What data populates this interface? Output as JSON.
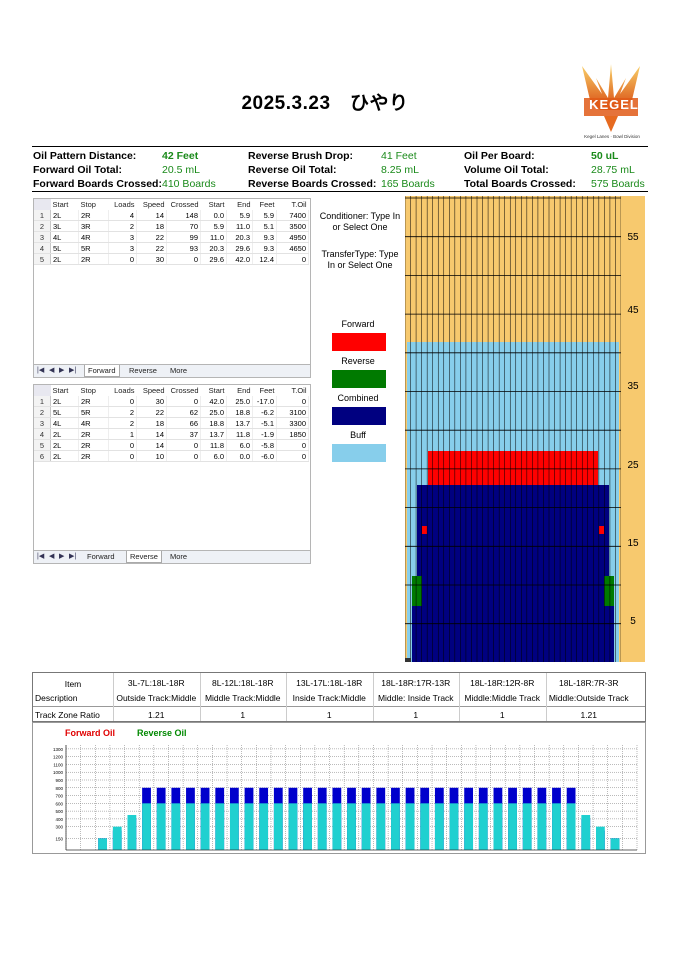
{
  "title": "2025.3.23　ひやり",
  "logo": {
    "text": "KEGEL",
    "caption": "Kegel Lanes · Bowl Division"
  },
  "summary": {
    "oil_pattern_distance_label": "Oil Pattern Distance:",
    "oil_pattern_distance": "42 Feet",
    "forward_oil_total_label": "Forward Oil Total:",
    "forward_oil_total": "20.5 mL",
    "forward_boards_crossed_label": "Forward Boards Crossed:",
    "forward_boards_crossed": "410 Boards",
    "reverse_brush_drop_label": "Reverse Brush Drop:",
    "reverse_brush_drop": "41 Feet",
    "reverse_oil_total_label": "Reverse Oil Total:",
    "reverse_oil_total": "8.25 mL",
    "reverse_boards_crossed_label": "Reverse Boards Crossed:",
    "reverse_boards_crossed": "165 Boards",
    "oil_per_board_label": "Oil Per Board:",
    "oil_per_board": "50 uL",
    "volume_oil_total_label": "Volume Oil Total:",
    "volume_oil_total": "28.75 mL",
    "total_boards_crossed_label": "Total Boards Crossed:",
    "total_boards_crossed": "575 Boards"
  },
  "forward_table": {
    "columns": [
      "Start",
      "Stop",
      "Loads",
      "Speed",
      "Crossed",
      "Start",
      "End",
      "Feet",
      "T.Oil"
    ],
    "rows": [
      [
        "1",
        "2L",
        "2R",
        "4",
        "14",
        "148",
        "0.0",
        "5.9",
        "5.9",
        "7400"
      ],
      [
        "2",
        "3L",
        "3R",
        "2",
        "18",
        "70",
        "5.9",
        "11.0",
        "5.1",
        "3500"
      ],
      [
        "3",
        "4L",
        "4R",
        "3",
        "22",
        "99",
        "11.0",
        "20.3",
        "9.3",
        "4950"
      ],
      [
        "4",
        "5L",
        "5R",
        "3",
        "22",
        "93",
        "20.3",
        "29.6",
        "9.3",
        "4650"
      ],
      [
        "5",
        "2L",
        "2R",
        "0",
        "30",
        "0",
        "29.6",
        "42.0",
        "12.4",
        "0"
      ]
    ],
    "tabs": [
      "Forward",
      "Reverse",
      "More"
    ]
  },
  "reverse_table": {
    "columns": [
      "Start",
      "Stop",
      "Loads",
      "Speed",
      "Crossed",
      "Start",
      "End",
      "Feet",
      "T.Oil"
    ],
    "rows": [
      [
        "1",
        "2L",
        "2R",
        "0",
        "30",
        "0",
        "42.0",
        "25.0",
        "-17.0",
        "0"
      ],
      [
        "2",
        "5L",
        "5R",
        "2",
        "22",
        "62",
        "25.0",
        "18.8",
        "-6.2",
        "3100"
      ],
      [
        "3",
        "4L",
        "4R",
        "2",
        "18",
        "66",
        "18.8",
        "13.7",
        "-5.1",
        "3300"
      ],
      [
        "4",
        "2L",
        "2R",
        "1",
        "14",
        "37",
        "13.7",
        "11.8",
        "-1.9",
        "1850"
      ],
      [
        "5",
        "2L",
        "2R",
        "0",
        "14",
        "0",
        "11.8",
        "6.0",
        "-5.8",
        "0"
      ],
      [
        "6",
        "2L",
        "2R",
        "0",
        "10",
        "0",
        "6.0",
        "0.0",
        "-6.0",
        "0"
      ]
    ],
    "tabs": [
      "Forward",
      "Reverse",
      "More"
    ]
  },
  "conditioner": {
    "conditioner_text": "Conditioner: Type In or Select One",
    "transfer_text": "TransferType: Type In or Select One"
  },
  "legend": [
    {
      "name": "Forward",
      "color": "#ff0000"
    },
    {
      "name": "Reverse",
      "color": "#007a00"
    },
    {
      "name": "Combined",
      "color": "#000080"
    },
    {
      "name": "Buff",
      "color": "#87ceeb"
    }
  ],
  "lane_graph": {
    "feet_markers": [
      "55",
      "45",
      "35",
      "25",
      "15",
      "5"
    ],
    "colors": {
      "wood": "#f7c96e",
      "buff": "#87ceeb",
      "forward": "#ff0000",
      "reverse": "#007a00",
      "combined": "#000080"
    }
  },
  "zone_table": {
    "item_label": "Item",
    "description_label": "Description",
    "ratio_label": "Track Zone Ratio",
    "zones": [
      {
        "item": "3L-7L:18L-18R",
        "desc": "Outside Track:Middle",
        "ratio": "1.21"
      },
      {
        "item": "8L-12L:18L-18R",
        "desc": "Middle Track:Middle",
        "ratio": "1"
      },
      {
        "item": "13L-17L:18L-18R",
        "desc": "Inside Track:Middle",
        "ratio": "1"
      },
      {
        "item": "18L-18R:17R-13R",
        "desc": "Middle: Inside Track",
        "ratio": "1"
      },
      {
        "item": "18L-18R:12R-8R",
        "desc": "Middle:Middle Track",
        "ratio": "1"
      },
      {
        "item": "18L-18R:7R-3R",
        "desc": "Middle:Outside Track",
        "ratio": "1.21"
      }
    ]
  },
  "chart_data": {
    "type": "bar",
    "legend": [
      "Forward Oil",
      "Reverse Oil"
    ],
    "y_ticks": [
      "1300",
      "1200",
      "1100",
      "1000",
      "900",
      "800",
      "700",
      "600",
      "500",
      "400",
      "300",
      "150"
    ],
    "ylim": [
      0,
      1350
    ],
    "boards": 39,
    "series": [
      {
        "name": "Reverse Oil",
        "color": "#20d0d0",
        "values": [
          0,
          0,
          150,
          300,
          450,
          600,
          600,
          600,
          600,
          600,
          600,
          600,
          600,
          600,
          600,
          600,
          600,
          600,
          600,
          600,
          600,
          600,
          600,
          600,
          600,
          600,
          600,
          600,
          600,
          600,
          600,
          600,
          600,
          600,
          600,
          450,
          300,
          150,
          0
        ]
      },
      {
        "name": "Forward Oil",
        "color": "#0000cc",
        "values": [
          0,
          0,
          150,
          250,
          400,
          800,
          800,
          800,
          800,
          800,
          800,
          800,
          800,
          800,
          800,
          800,
          800,
          800,
          800,
          800,
          800,
          800,
          800,
          800,
          800,
          800,
          800,
          800,
          800,
          800,
          800,
          800,
          800,
          800,
          800,
          400,
          250,
          150,
          0
        ]
      }
    ]
  }
}
